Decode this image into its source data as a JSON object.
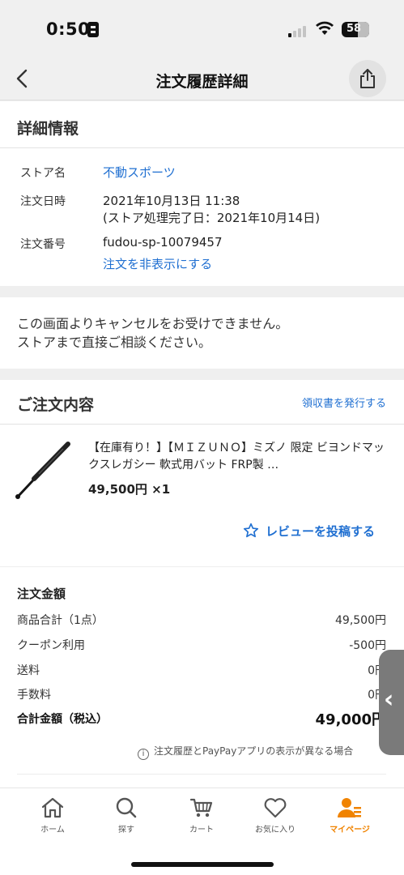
{
  "status_bar": {
    "time": "0:50",
    "battery": "58"
  },
  "header": {
    "title": "注文履歴詳細",
    "back_icon": "chevron-left-icon",
    "share_icon": "share-icon"
  },
  "details": {
    "heading": "詳細情報",
    "store_label": "ストア名",
    "store_name": "不動スポーツ",
    "date_label": "注文日時",
    "date_value": "2021年10月13日 11:38",
    "date_sub": "(ストア処理完了日：2021年10月14日)",
    "order_label": "注文番号",
    "order_number": "fudou-sp-10079457",
    "hide_link": "注文を非表示にする"
  },
  "cancel_note": {
    "line1": "この画面よりキャンセルをお受けできません。",
    "line2": "ストアまで直接ご相談ください。"
  },
  "order": {
    "heading": "ご注文内容",
    "receipt_link": "領収書を発行する",
    "product_name": "【在庫有り！】【ＭＩＺＵＮＯ】ミズノ 限定 ビヨンドマックスレガシー 軟式用バット FRP製 …",
    "price": "49,500円",
    "quantity": "×1",
    "review_link": "レビューを投稿する"
  },
  "amount": {
    "title": "注文金額",
    "rows": [
      {
        "label": "商品合計（1点）",
        "value": "49,500円"
      },
      {
        "label": "クーポン利用",
        "value": "-500円"
      },
      {
        "label": "送料",
        "value": "0円"
      },
      {
        "label": "手数料",
        "value": "0円"
      }
    ],
    "total_label": "合計金額（税込）",
    "total_value": "49,000円",
    "note": "注文履歴とPayPayアプリの表示が異なる場合"
  },
  "bottom_nav": [
    {
      "label": "ホーム",
      "icon": "home-icon"
    },
    {
      "label": "探す",
      "icon": "search-icon"
    },
    {
      "label": "カート",
      "icon": "cart-icon"
    },
    {
      "label": "お気に入り",
      "icon": "heart-icon"
    },
    {
      "label": "マイページ",
      "icon": "person-icon",
      "active": true
    }
  ],
  "colors": {
    "link": "#1f6fd1",
    "active_tab": "#f08300"
  }
}
